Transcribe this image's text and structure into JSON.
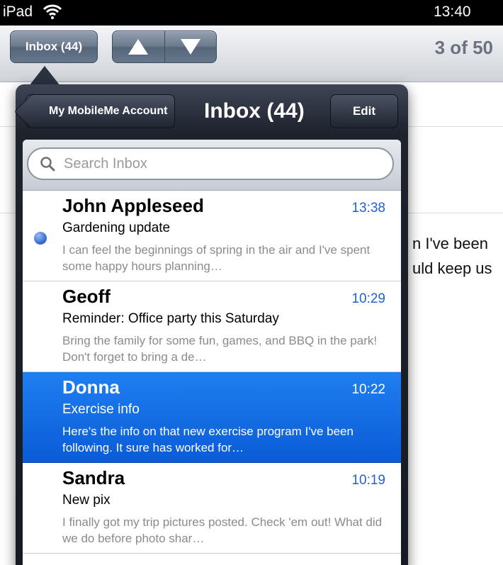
{
  "status_bar": {
    "device": "iPad",
    "time": "13:40"
  },
  "toolbar": {
    "inbox_button": "Inbox (44)",
    "counter": "3 of 50"
  },
  "background_message": {
    "line1": "n I've been",
    "line2": "uld keep us"
  },
  "popover": {
    "back_button": "My MobileMe Account",
    "title": "Inbox (44)",
    "edit_button": "Edit",
    "search_placeholder": "Search Inbox",
    "messages": [
      {
        "sender": "John Appleseed",
        "time": "13:38",
        "subject": "Gardening update",
        "preview": "I can feel the beginnings of spring in the air and I've spent some happy hours planning…",
        "unread": true,
        "selected": false
      },
      {
        "sender": "Geoff",
        "time": "10:29",
        "subject": "Reminder: Office party this Saturday",
        "preview": "Bring the family for some fun, games, and BBQ in the park! Don't forget to bring a de…",
        "unread": false,
        "selected": false
      },
      {
        "sender": "Donna",
        "time": "10:22",
        "subject": "Exercise info",
        "preview": "Here's the info on that new exercise program I've been following. It sure has worked for…",
        "unread": false,
        "selected": true
      },
      {
        "sender": "Sandra",
        "time": "10:19",
        "subject": "New pix",
        "preview": "I finally got my trip pictures posted. Check 'em out! What did we do before photo shar…",
        "unread": false,
        "selected": false
      }
    ]
  },
  "colors": {
    "accent_blue": "#2360d3",
    "selection_blue": "#1f7ff0",
    "popover_dark": "#1d222c"
  }
}
